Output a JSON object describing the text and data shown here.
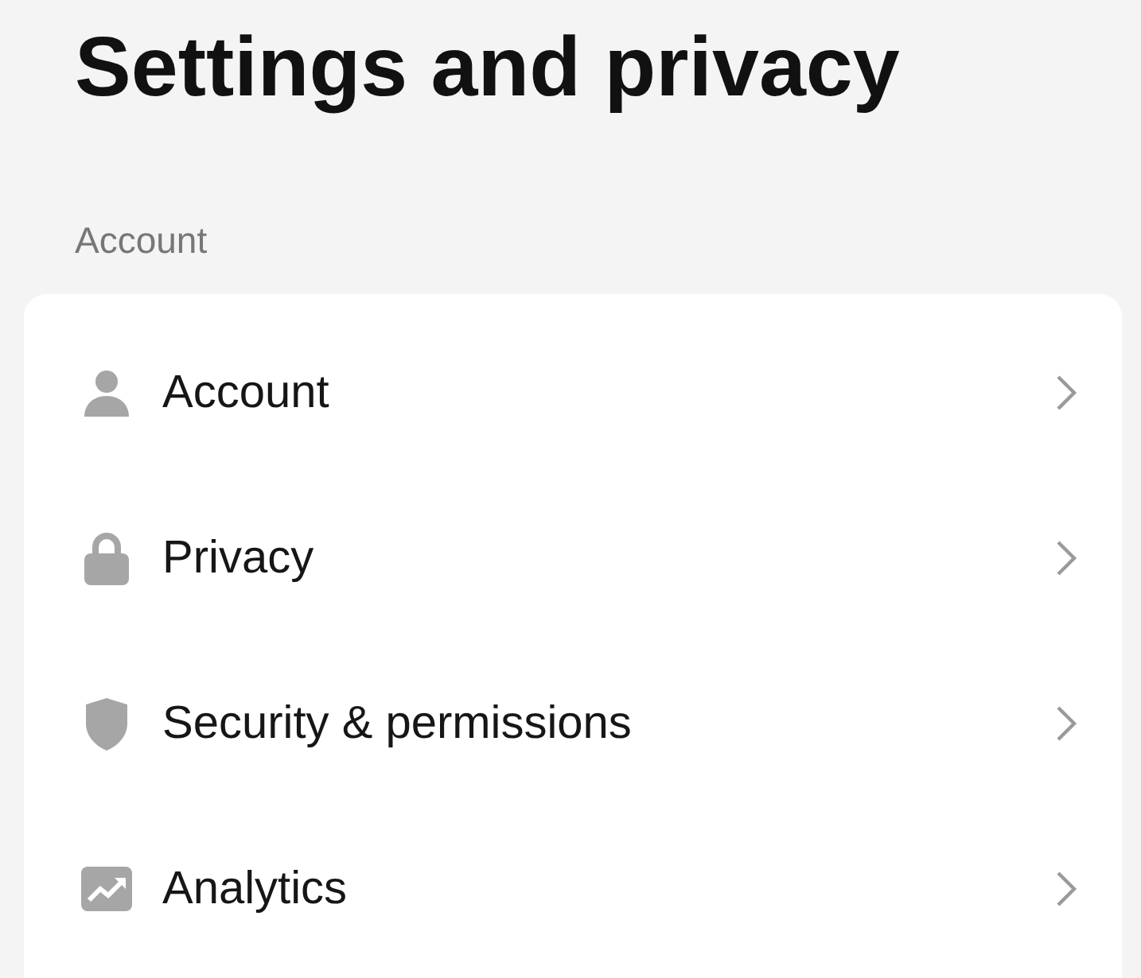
{
  "title": "Settings and privacy",
  "sections": [
    {
      "label": "Account",
      "items": [
        {
          "label": "Account"
        },
        {
          "label": "Privacy"
        },
        {
          "label": "Security & permissions"
        },
        {
          "label": "Analytics"
        }
      ]
    }
  ]
}
